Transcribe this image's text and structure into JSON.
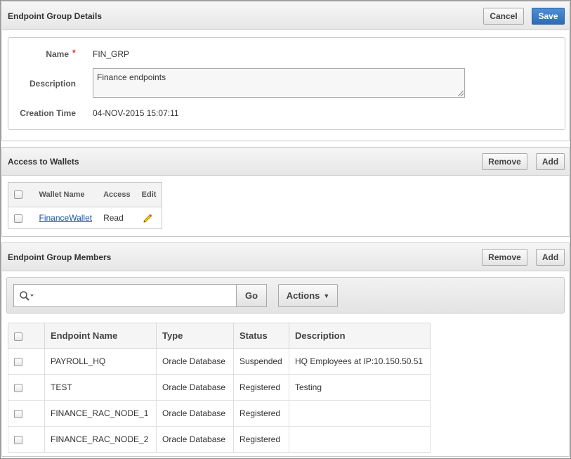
{
  "details": {
    "title": "Endpoint Group Details",
    "cancel_label": "Cancel",
    "save_label": "Save",
    "name_label": "Name",
    "required_mark": "*",
    "name_value": "FIN_GRP",
    "description_label": "Description",
    "description_value": "Finance endpoints",
    "creation_label": "Creation Time",
    "creation_value": "04-NOV-2015 15:07:11"
  },
  "wallets": {
    "title": "Access to Wallets",
    "remove_label": "Remove",
    "add_label": "Add",
    "columns": [
      "Wallet Name",
      "Access",
      "Edit"
    ],
    "rows": [
      {
        "wallet_name": "FinanceWallet",
        "access": "Read",
        "edit_icon": "pencil-icon"
      }
    ]
  },
  "members": {
    "title": "Endpoint Group Members",
    "remove_label": "Remove",
    "add_label": "Add",
    "search": {
      "placeholder": "",
      "go_label": "Go",
      "search_icon": "magnifier-icon"
    },
    "actions_label": "Actions",
    "columns": [
      "Endpoint Name",
      "Type",
      "Status",
      "Description"
    ],
    "rows": [
      {
        "name": "PAYROLL_HQ",
        "type": "Oracle Database",
        "status": "Suspended",
        "description": "HQ Employees at IP:10.150.50.51"
      },
      {
        "name": "TEST",
        "type": "Oracle Database",
        "status": "Registered",
        "description": "Testing"
      },
      {
        "name": "FINANCE_RAC_NODE_1",
        "type": "Oracle Database",
        "status": "Registered",
        "description": ""
      },
      {
        "name": "FINANCE_RAC_NODE_2",
        "type": "Oracle Database",
        "status": "Registered",
        "description": ""
      }
    ]
  },
  "colors": {
    "primary_button": "#2c6bb6",
    "required": "#d12a2a",
    "link": "#1f4f9a",
    "pencil": "#e0b000"
  }
}
